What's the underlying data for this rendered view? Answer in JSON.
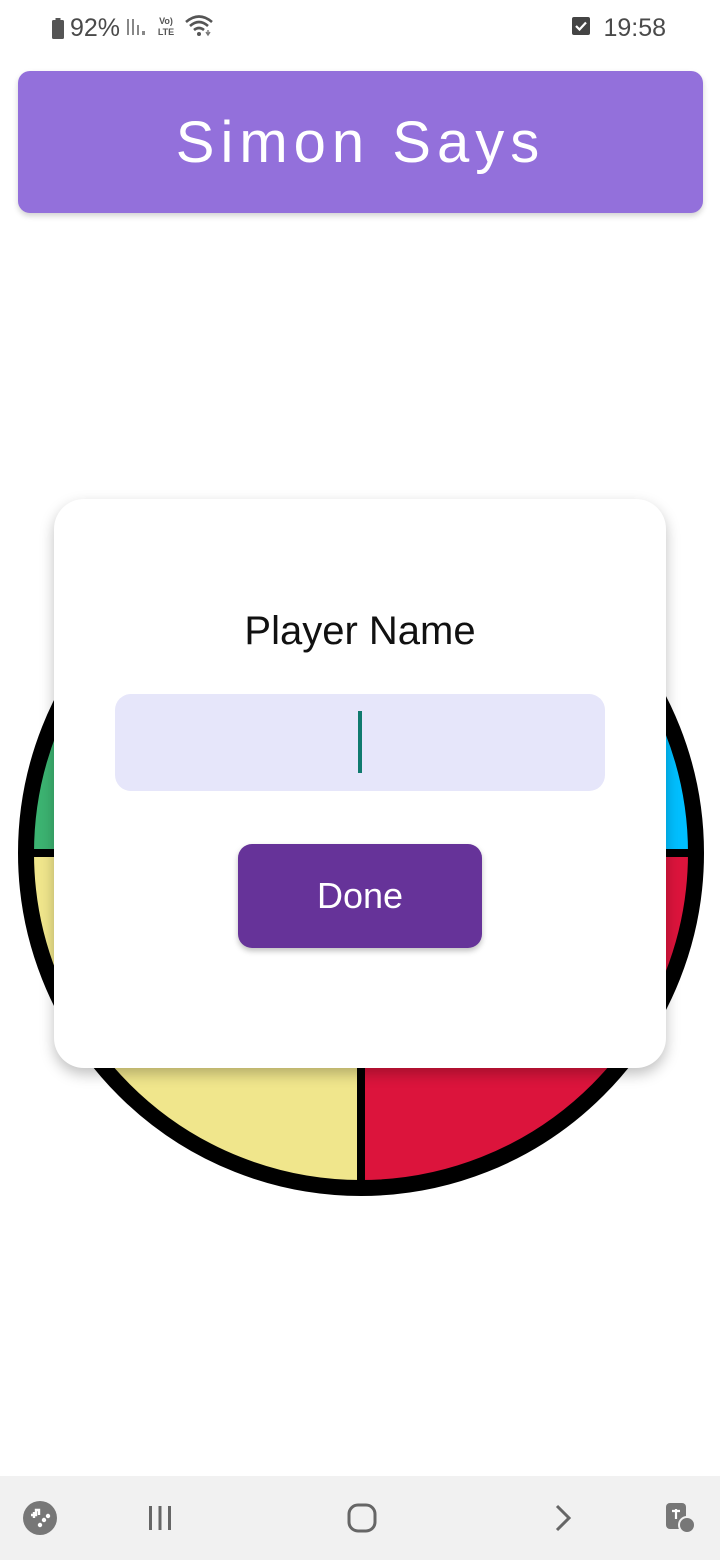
{
  "status_bar": {
    "battery": "92%",
    "time": "19:58",
    "icons": [
      "battery-icon",
      "signal-icon",
      "volte-lte-icon",
      "wifi-icon",
      "checkbox-notification-icon"
    ]
  },
  "app_bar": {
    "title": "Simon Says",
    "color": "#9370db"
  },
  "board": {
    "quadrants": [
      {
        "name": "green",
        "color": "#3cb371"
      },
      {
        "name": "blue",
        "color": "#00bfff"
      },
      {
        "name": "yellow",
        "color": "#f0e68c"
      },
      {
        "name": "red",
        "color": "#dc143c"
      }
    ],
    "border_color": "#000000"
  },
  "dialog": {
    "title": "Player Name",
    "input": {
      "value": "",
      "placeholder": "",
      "background": "#e6e6fa"
    },
    "done_label": "Done",
    "done_color": "#663399"
  },
  "nav_bar": {
    "items": [
      "game-launcher-icon",
      "recent-apps-icon",
      "home-icon",
      "forward-icon",
      "accessibility-icon"
    ]
  }
}
